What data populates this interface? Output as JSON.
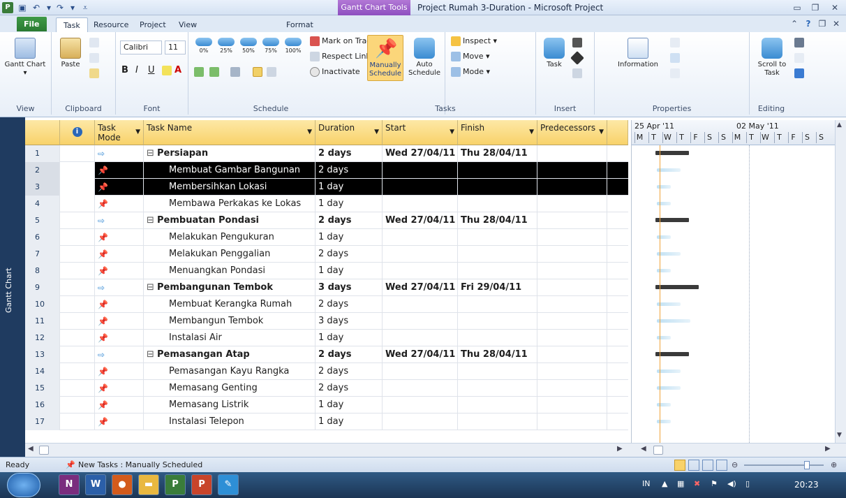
{
  "window": {
    "context_tab": "Gantt Chart Tools",
    "title": "Project Rumah 3-Duration  -  Microsoft Project"
  },
  "tabs": [
    "File",
    "Task",
    "Resource",
    "Project",
    "View",
    "Format"
  ],
  "ribbon": {
    "view": {
      "btn": "Gantt Chart ▾",
      "label": "View"
    },
    "clipboard": {
      "paste": "Paste",
      "label": "Clipboard"
    },
    "font": {
      "family": "Calibri",
      "size": "11",
      "label": "Font"
    },
    "schedule": {
      "pcts": [
        "0%",
        "25%",
        "50%",
        "75%",
        "100%"
      ],
      "mark_on_track": "Mark on Track ▾",
      "respect_links": "Respect Links",
      "inactivate": "Inactivate",
      "label": "Schedule"
    },
    "tasks": {
      "manually": "Manually Schedule",
      "auto": "Auto Schedule",
      "inspect": "Inspect ▾",
      "move": "Move ▾",
      "mode": "Mode ▾",
      "label": "Tasks"
    },
    "insert": {
      "task": "Task",
      "label": "Insert"
    },
    "properties": {
      "information": "Information",
      "label": "Properties"
    },
    "editing": {
      "scroll": "Scroll to Task",
      "label": "Editing"
    }
  },
  "side_label": "Gantt Chart",
  "columns": [
    "Task Mode",
    "Task Name",
    "Duration",
    "Start",
    "Finish",
    "Predecessors"
  ],
  "rows": [
    {
      "id": "1",
      "mode": "auto",
      "name": "Persiapan",
      "summary": true,
      "duration": "2 days",
      "start": "Wed 27/04/11",
      "finish": "Thu 28/04/11"
    },
    {
      "id": "2",
      "mode": "manual",
      "name": "Membuat Gambar Bangunan",
      "summary": false,
      "duration": "2 days",
      "start": "",
      "finish": "",
      "selected": true
    },
    {
      "id": "3",
      "mode": "manual",
      "name": "Membersihkan Lokasi",
      "summary": false,
      "duration": "1 day",
      "start": "",
      "finish": "",
      "selected": true
    },
    {
      "id": "4",
      "mode": "manual",
      "name": "Membawa Perkakas ke Lokas",
      "summary": false,
      "duration": "1 day",
      "start": "",
      "finish": ""
    },
    {
      "id": "5",
      "mode": "auto",
      "name": "Pembuatan Pondasi",
      "summary": true,
      "duration": "2 days",
      "start": "Wed 27/04/11",
      "finish": "Thu 28/04/11"
    },
    {
      "id": "6",
      "mode": "manual",
      "name": "Melakukan Pengukuran",
      "summary": false,
      "duration": "1 day",
      "start": "",
      "finish": ""
    },
    {
      "id": "7",
      "mode": "manual",
      "name": "Melakukan Penggalian",
      "summary": false,
      "duration": "2 days",
      "start": "",
      "finish": ""
    },
    {
      "id": "8",
      "mode": "manual",
      "name": "Menuangkan Pondasi",
      "summary": false,
      "duration": "1 day",
      "start": "",
      "finish": ""
    },
    {
      "id": "9",
      "mode": "auto",
      "name": "Pembangunan Tembok",
      "summary": true,
      "duration": "3 days",
      "start": "Wed 27/04/11",
      "finish": "Fri 29/04/11"
    },
    {
      "id": "10",
      "mode": "manual",
      "name": "Membuat Kerangka Rumah",
      "summary": false,
      "duration": "2 days",
      "start": "",
      "finish": ""
    },
    {
      "id": "11",
      "mode": "manual",
      "name": "Membangun Tembok",
      "summary": false,
      "duration": "3 days",
      "start": "",
      "finish": ""
    },
    {
      "id": "12",
      "mode": "manual",
      "name": "Instalasi Air",
      "summary": false,
      "duration": "1 day",
      "start": "",
      "finish": ""
    },
    {
      "id": "13",
      "mode": "auto",
      "name": "Pemasangan Atap",
      "summary": true,
      "duration": "2 days",
      "start": "Wed 27/04/11",
      "finish": "Thu 28/04/11"
    },
    {
      "id": "14",
      "mode": "manual",
      "name": "Pemasangan Kayu Rangka",
      "summary": false,
      "duration": "2 days",
      "start": "",
      "finish": ""
    },
    {
      "id": "15",
      "mode": "manual",
      "name": "Memasang Genting",
      "summary": false,
      "duration": "2 days",
      "start": "",
      "finish": ""
    },
    {
      "id": "16",
      "mode": "manual",
      "name": "Memasang Listrik",
      "summary": false,
      "duration": "1 day",
      "start": "",
      "finish": ""
    },
    {
      "id": "17",
      "mode": "manual",
      "name": "Instalasi Telepon",
      "summary": false,
      "duration": "1 day",
      "start": "",
      "finish": ""
    }
  ],
  "gantt": {
    "weeks": [
      "25 Apr '11",
      "02 May '11"
    ],
    "days": [
      "M",
      "T",
      "W",
      "T",
      "F",
      "S",
      "S",
      "M",
      "T",
      "W",
      "T",
      "F",
      "S",
      "S"
    ]
  },
  "status": {
    "ready": "Ready",
    "new_tasks": "New Tasks : Manually Scheduled"
  },
  "taskbar": {
    "lang": "IN",
    "time": "20:23"
  },
  "colors": {
    "accent": "#f0a33a",
    "header": "#f8d26a",
    "selection": "#000000",
    "contextual": "#8e4fc0"
  }
}
